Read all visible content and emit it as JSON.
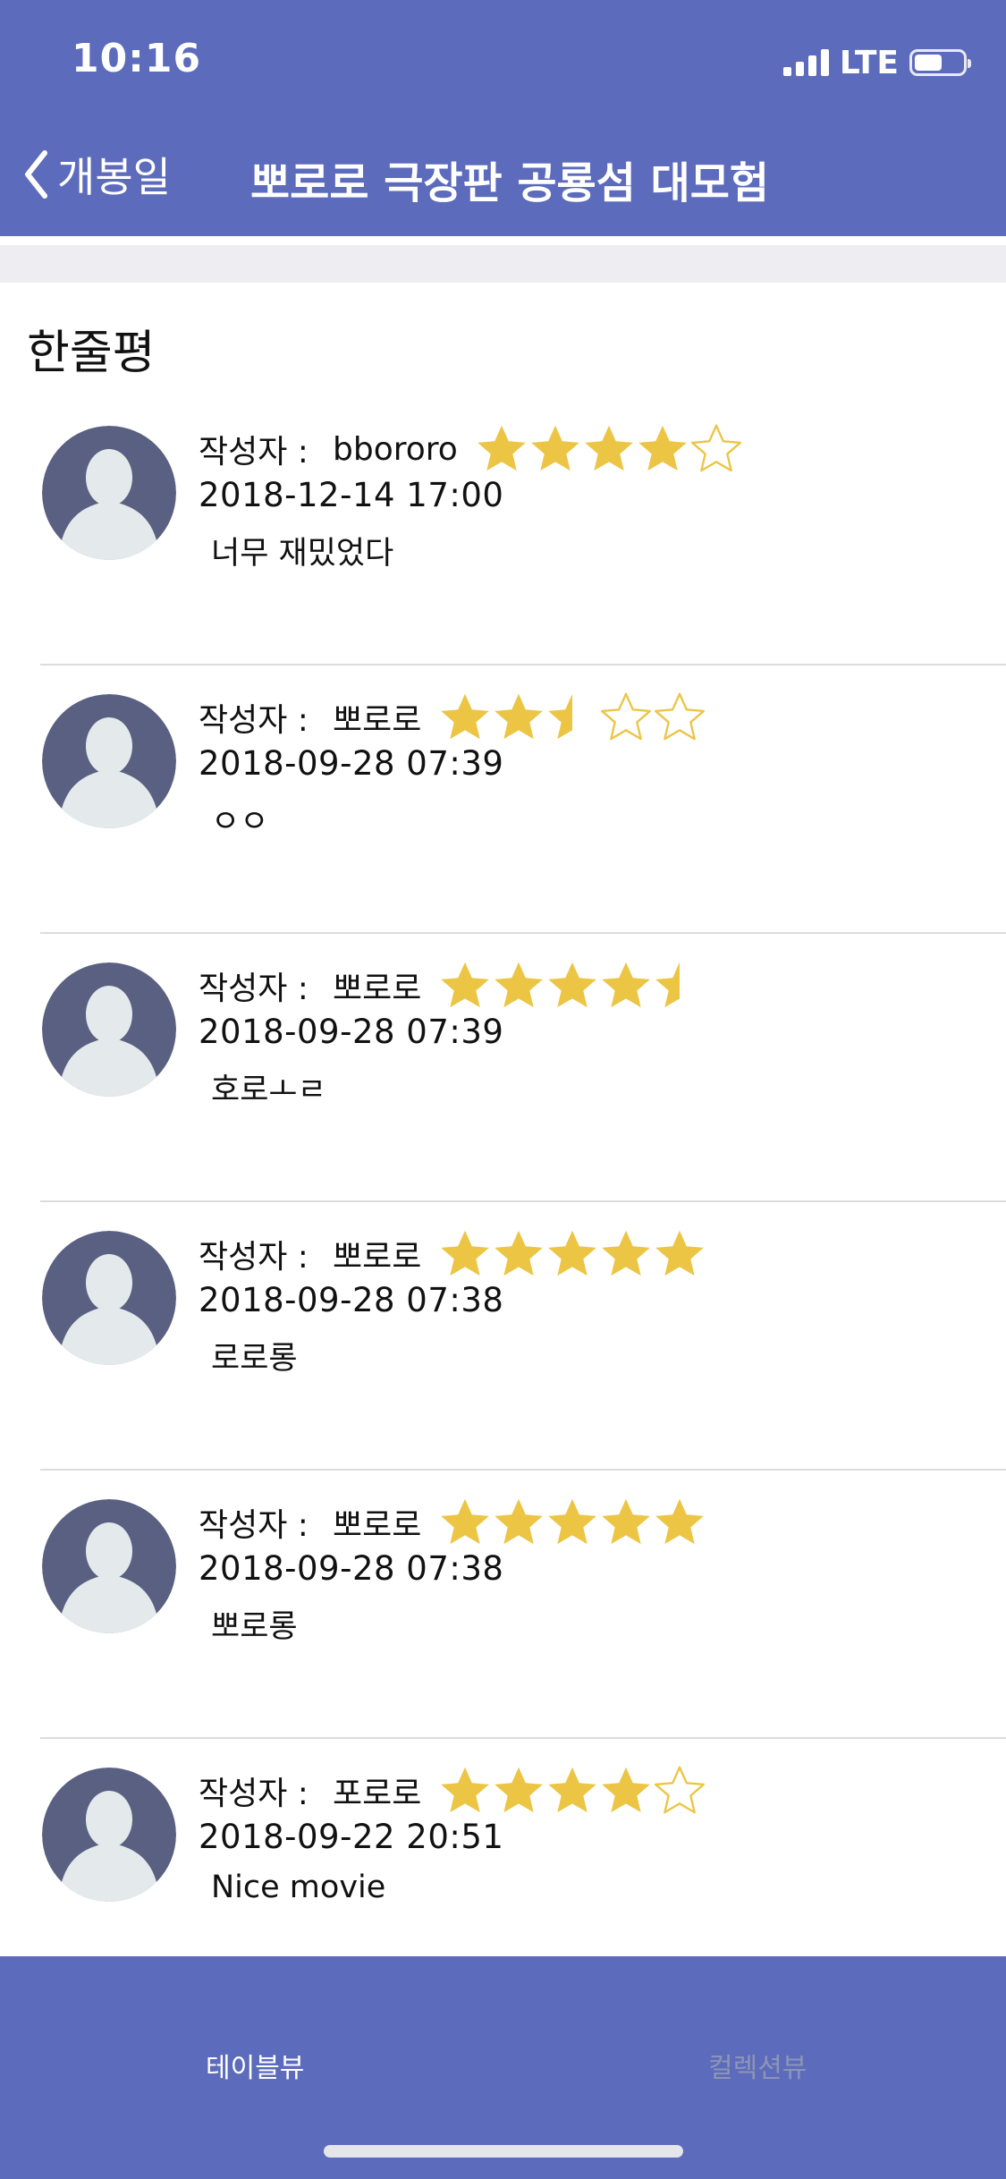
{
  "status_bar": {
    "time": "10:16",
    "network": "LTE"
  },
  "nav": {
    "back_label": "개봉일",
    "title": "뽀로로 극장판 공룡섬 대모험"
  },
  "section": {
    "title": "한줄평"
  },
  "author_label": "작성자 :",
  "reviews": [
    {
      "author": "bbororo",
      "rating": 4,
      "date": "2018-12-14 17:00",
      "comment": "너무 재밌었다"
    },
    {
      "author": "뽀로로",
      "rating": 2.5,
      "date": "2018-09-28 07:39",
      "comment": "ㅇㅇ"
    },
    {
      "author": "뽀로로",
      "rating": 4.5,
      "date": "2018-09-28 07:39",
      "comment": "호로ㅗㄹ"
    },
    {
      "author": "뽀로로",
      "rating": 5,
      "date": "2018-09-28 07:38",
      "comment": "로로롱"
    },
    {
      "author": "뽀로로",
      "rating": 5,
      "date": "2018-09-28 07:38",
      "comment": "뽀로롱"
    },
    {
      "author": "포로로",
      "rating": 4,
      "date": "2018-09-22 20:51",
      "comment": "Nice movie"
    }
  ],
  "tabs": {
    "table_view": "테이블뷰",
    "collection_view": "컬렉션뷰"
  },
  "colors": {
    "brand": "#5c6bbb",
    "star": "#ecc545",
    "avatar_bg": "#5a6081",
    "avatar_figure": "#e4e9ec"
  }
}
